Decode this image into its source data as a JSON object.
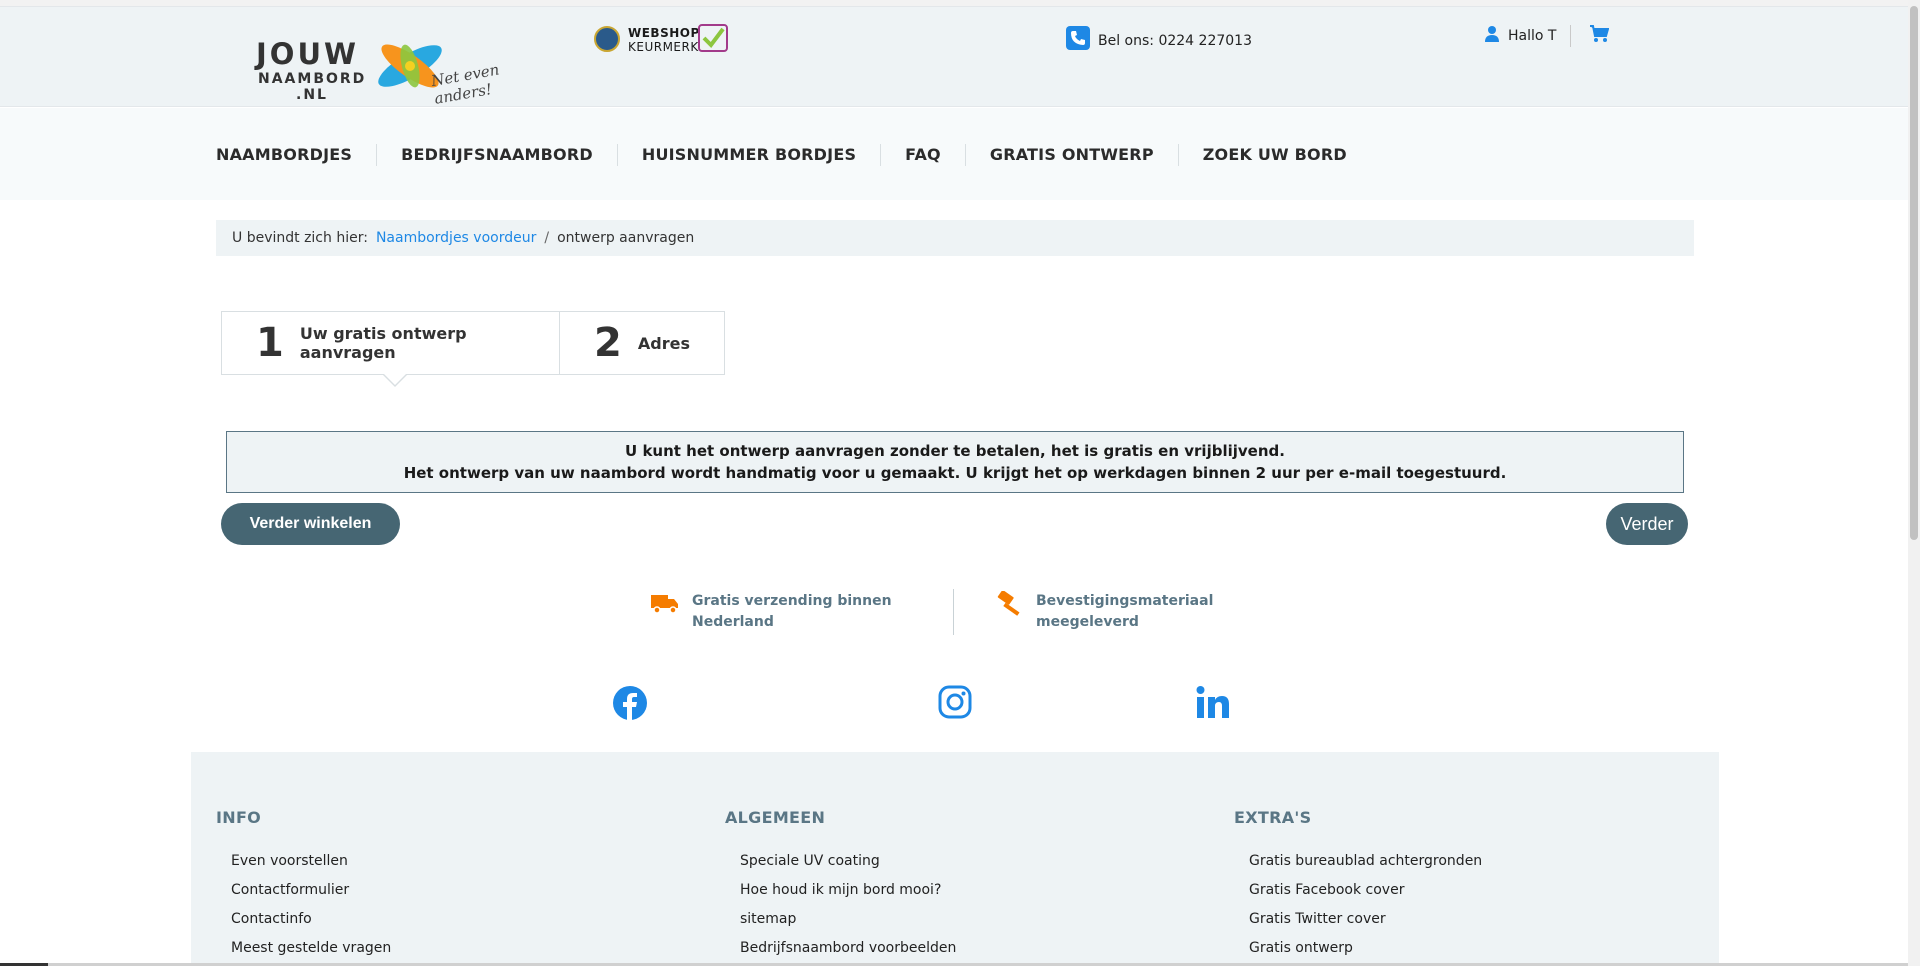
{
  "header": {
    "logo": {
      "line1": "JOUW",
      "line2": "NAAMBORD",
      "line3": ".NL",
      "tagline": "Net even anders!"
    },
    "keurmerk": {
      "line1": "WEBSHOP",
      "line2": "KEURMERK"
    },
    "phone": "Bel ons: 0224 227013",
    "user_greeting": "Hallo T"
  },
  "nav": {
    "items": [
      {
        "label": "NAAMBORDJES"
      },
      {
        "label": "BEDRIJFSNAAMBORD"
      },
      {
        "label": "HUISNUMMER BORDJES"
      },
      {
        "label": "FAQ"
      },
      {
        "label": "GRATIS ONTWERP"
      },
      {
        "label": "ZOEK UW BORD"
      }
    ]
  },
  "breadcrumb": {
    "prefix": "U bevindt zich hier:",
    "link": "Naambordjes voordeur",
    "separator": "/",
    "current": "ontwerp aanvragen"
  },
  "steps": [
    {
      "number": "1",
      "label": "Uw gratis ontwerp aanvragen",
      "active": true
    },
    {
      "number": "2",
      "label": "Adres",
      "active": false
    }
  ],
  "notice": {
    "line1": "U kunt het ontwerp aanvragen zonder te betalen, het is gratis en vrijblijvend.",
    "line2": "Het ontwerp van uw naambord wordt handmatig voor u gemaakt. U krijgt het op werkdagen binnen 2 uur per e-mail toegestuurd."
  },
  "buttons": {
    "continue_shopping": "Verder winkelen",
    "next": "Verder"
  },
  "usps": [
    {
      "icon": "truck-icon",
      "line1": "Gratis verzending binnen",
      "line2": "Nederland"
    },
    {
      "icon": "hammer-icon",
      "line1": "Bevestigingsmateriaal",
      "line2": "meegeleverd"
    }
  ],
  "social": [
    "facebook-icon",
    "instagram-icon",
    "linkedin-icon"
  ],
  "footer": {
    "columns": [
      {
        "title": "INFO",
        "items": [
          "Even voorstellen",
          "Contactformulier",
          "Contactinfo",
          "Meest gestelde vragen"
        ]
      },
      {
        "title": "ALGEMEEN",
        "items": [
          "Speciale UV coating",
          "Hoe houd ik mijn bord mooi?",
          "sitemap",
          "Bedrijfsnaambord voorbeelden"
        ]
      },
      {
        "title": "EXTRA'S",
        "items": [
          "Gratis bureaublad achtergronden",
          "Gratis Facebook cover",
          "Gratis Twitter cover",
          "Gratis ontwerp"
        ]
      }
    ]
  },
  "colors": {
    "accent_blue": "#1e88e5",
    "button_slate": "#466673",
    "usp_orange": "#f57c00",
    "muted_text": "#5a7685",
    "panel_bg": "#eef3f5"
  }
}
